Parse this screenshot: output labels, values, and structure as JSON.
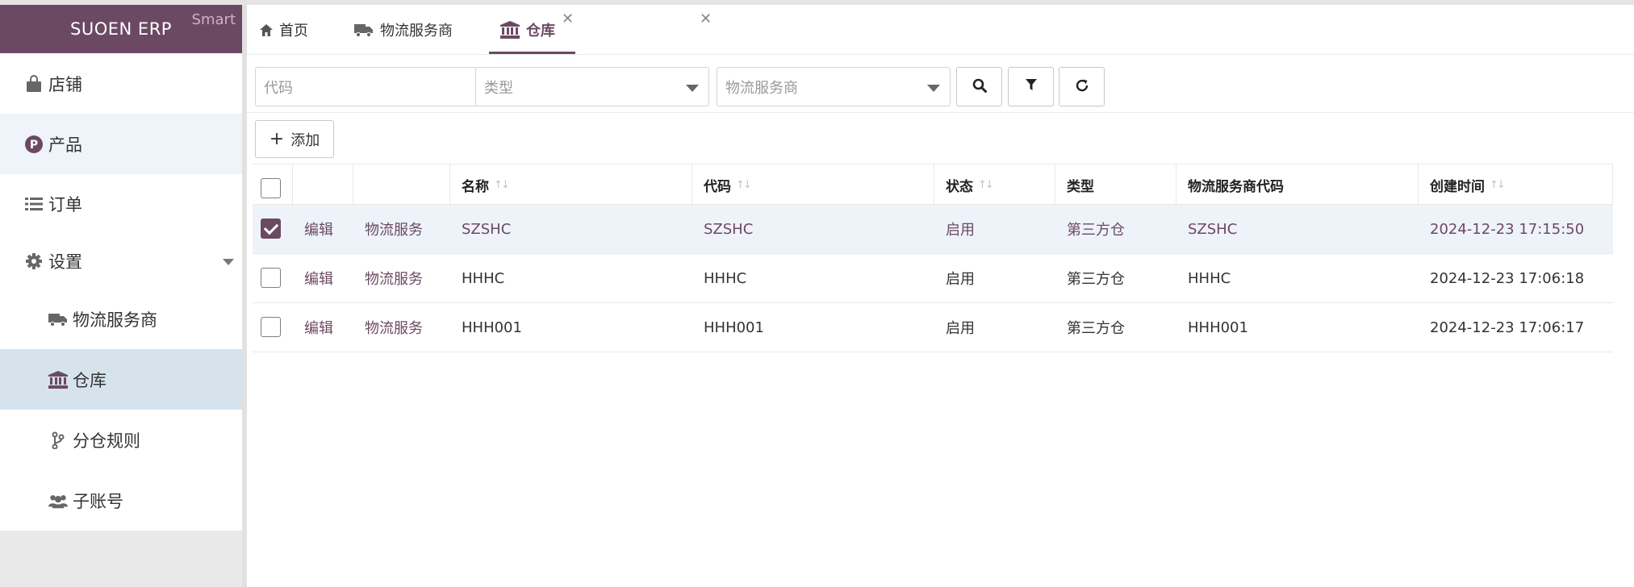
{
  "brand": {
    "title": "SUOEN ERP",
    "badge": "Smart",
    "color": "#6c4963"
  },
  "sidebar": {
    "items": [
      {
        "label": "店铺",
        "icon": "shopping-bag-icon"
      },
      {
        "label": "产品",
        "icon": "product-p-icon"
      },
      {
        "label": "订单",
        "icon": "list-icon"
      },
      {
        "label": "设置",
        "icon": "gear-icon"
      },
      {
        "label": "物流服务商",
        "icon": "truck-icon"
      },
      {
        "label": "仓库",
        "icon": "bank-icon"
      },
      {
        "label": "分仓规则",
        "icon": "branch-icon"
      },
      {
        "label": "子账号",
        "icon": "users-icon"
      }
    ]
  },
  "tabs": [
    {
      "label": "首页",
      "icon": "home-icon"
    },
    {
      "label": "物流服务商",
      "icon": "truck-icon"
    },
    {
      "label": "仓库",
      "icon": "bank-icon"
    }
  ],
  "filters": {
    "code_placeholder": "代码",
    "type_placeholder": "类型",
    "provider_placeholder": "物流服务商"
  },
  "toolbar": {
    "add_label": "添加"
  },
  "table": {
    "headers": [
      "名称",
      "代码",
      "状态",
      "类型",
      "物流服务商代码",
      "创建时间"
    ],
    "rows": [
      {
        "edit": "编辑",
        "service": "物流服务",
        "name": "SZSHC",
        "code": "SZSHC",
        "status": "启用",
        "type": "第三方仓",
        "provider_code": "SZSHC",
        "created": "2024-12-23 17:15:50",
        "checked": true
      },
      {
        "edit": "编辑",
        "service": "物流服务",
        "name": "HHHC",
        "code": "HHHC",
        "status": "启用",
        "type": "第三方仓",
        "provider_code": "HHHC",
        "created": "2024-12-23 17:06:18",
        "checked": false
      },
      {
        "edit": "编辑",
        "service": "物流服务",
        "name": "HHH001",
        "code": "HHH001",
        "status": "启用",
        "type": "第三方仓",
        "provider_code": "HHH001",
        "created": "2024-12-23 17:06:17",
        "checked": false
      }
    ]
  },
  "colors": {
    "accent": "#6c4963",
    "selected_row": "#eef3fa",
    "active_menu": "#d7e3ec"
  }
}
